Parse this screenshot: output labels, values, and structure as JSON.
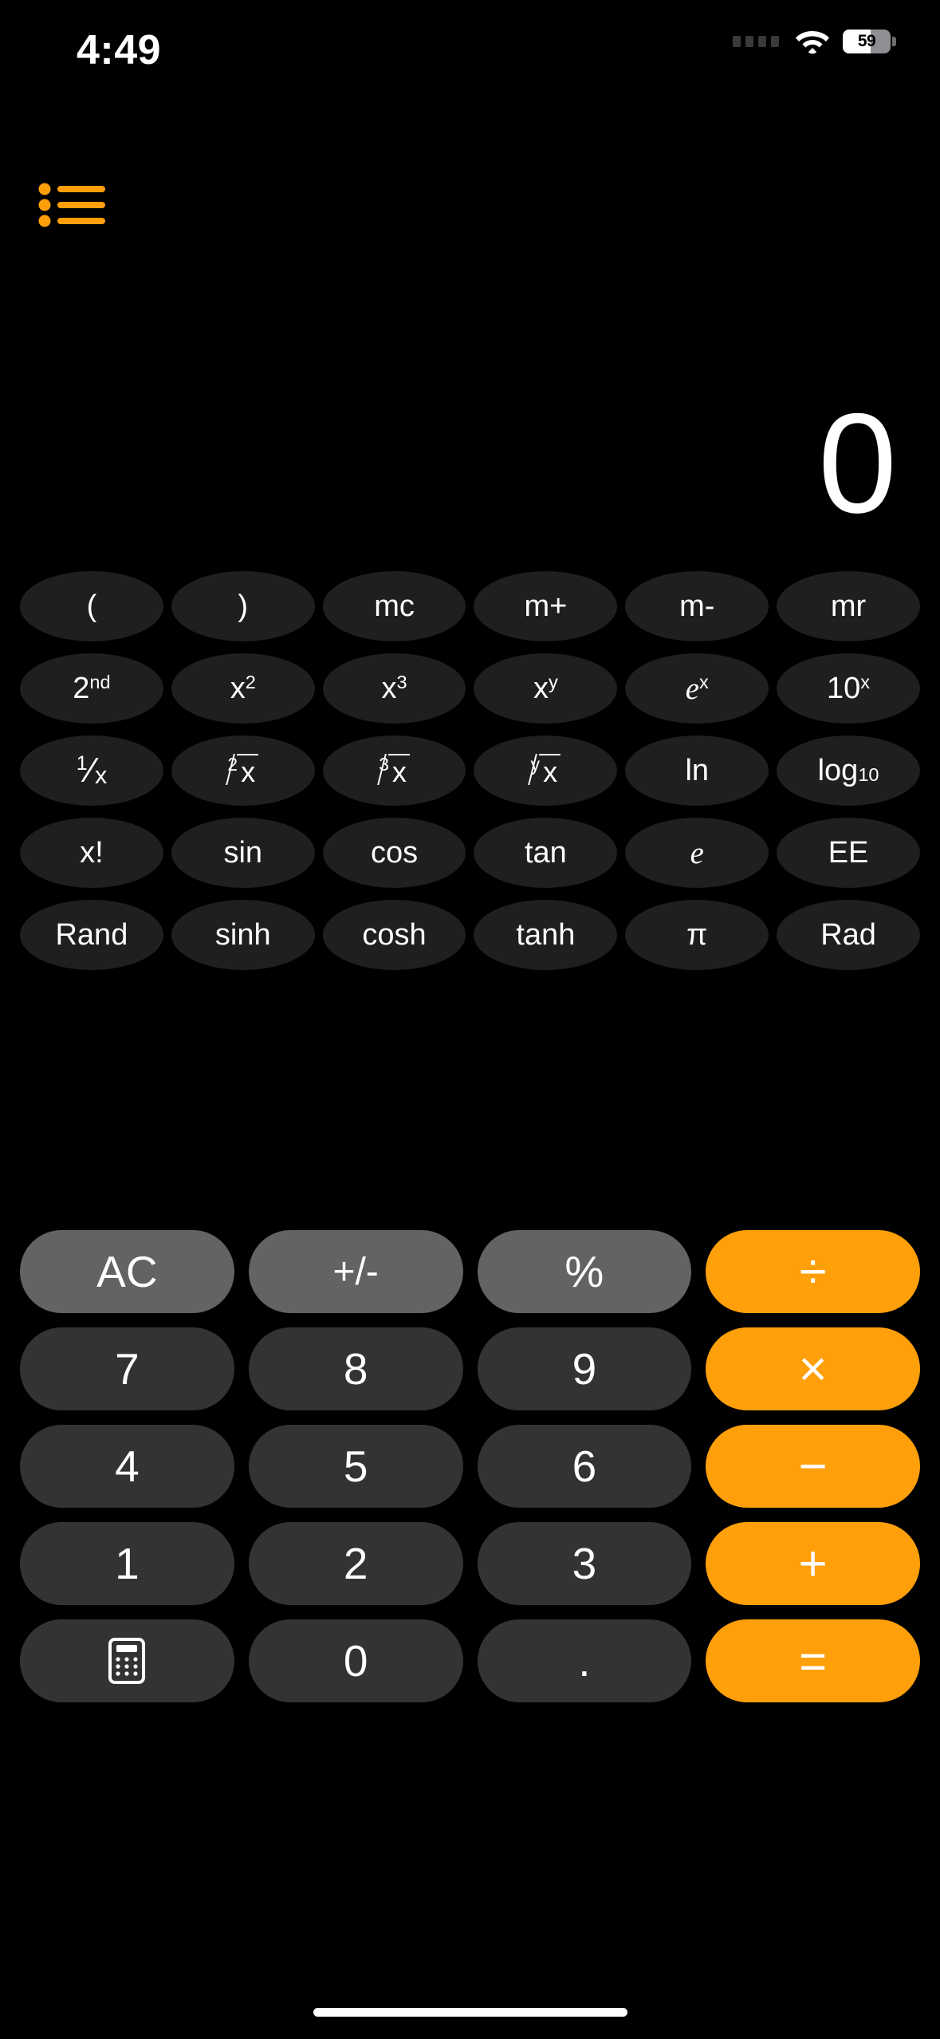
{
  "status_bar": {
    "time": "4:49",
    "battery_percent": "59",
    "battery_level": 59,
    "wifi_icon": "wifi-icon",
    "signal_icon": "signal-dots-icon"
  },
  "toolbar": {
    "history_label": "history-list-icon",
    "accent_color": "#ff9f0a"
  },
  "display": {
    "value": "0"
  },
  "colors": {
    "background": "#000000",
    "sci_key": "#1f1f1f",
    "digit_key": "#333333",
    "function_key": "#636366",
    "operator_key": "#ff9f0a",
    "text": "#ffffff"
  },
  "scientific_rows": [
    [
      {
        "label": "(",
        "name": "key-open-paren"
      },
      {
        "label": ")",
        "name": "key-close-paren"
      },
      {
        "label": "mc",
        "name": "key-memory-clear"
      },
      {
        "label": "m+",
        "name": "key-memory-add"
      },
      {
        "label": "m-",
        "name": "key-memory-subtract"
      },
      {
        "label": "mr",
        "name": "key-memory-recall"
      }
    ],
    [
      {
        "label": "2nd",
        "name": "key-second"
      },
      {
        "label": "x2",
        "name": "key-x-squared"
      },
      {
        "label": "x3",
        "name": "key-x-cubed"
      },
      {
        "label": "xy",
        "name": "key-x-power-y"
      },
      {
        "label": "ex",
        "name": "key-e-power-x"
      },
      {
        "label": "10x",
        "name": "key-ten-power-x"
      }
    ],
    [
      {
        "label": "1/x",
        "name": "key-reciprocal"
      },
      {
        "label": "2√x",
        "name": "key-square-root"
      },
      {
        "label": "3√x",
        "name": "key-cube-root"
      },
      {
        "label": "y√x",
        "name": "key-nth-root"
      },
      {
        "label": "ln",
        "name": "key-natural-log"
      },
      {
        "label": "log10",
        "name": "key-log-base-10"
      }
    ],
    [
      {
        "label": "x!",
        "name": "key-factorial"
      },
      {
        "label": "sin",
        "name": "key-sin"
      },
      {
        "label": "cos",
        "name": "key-cos"
      },
      {
        "label": "tan",
        "name": "key-tan"
      },
      {
        "label": "e",
        "name": "key-euler"
      },
      {
        "label": "EE",
        "name": "key-exponent"
      }
    ],
    [
      {
        "label": "Rand",
        "name": "key-random"
      },
      {
        "label": "sinh",
        "name": "key-sinh"
      },
      {
        "label": "cosh",
        "name": "key-cosh"
      },
      {
        "label": "tanh",
        "name": "key-tanh"
      },
      {
        "label": "π",
        "name": "key-pi"
      },
      {
        "label": "Rad",
        "name": "key-rad"
      }
    ]
  ],
  "sci_labels": {
    "r0": {
      "c0": "(",
      "c1": ")",
      "c2": "mc",
      "c3": "m+",
      "c4": "m-",
      "c5": "mr"
    },
    "r1": {
      "c0_base": "2",
      "c0_sup": "nd",
      "c1_base": "x",
      "c1_sup": "2",
      "c2_base": "x",
      "c2_sup": "3",
      "c3_base": "x",
      "c3_sup": "y",
      "c4_base": "e",
      "c4_sup": "x",
      "c5_base": "10",
      "c5_sup": "x"
    },
    "r2": {
      "c0_num": "1",
      "c0_den": "x",
      "c1_idx": "2",
      "c1_val": "x",
      "c2_idx": "3",
      "c2_val": "x",
      "c3_idx": "y",
      "c3_val": "x",
      "c4": "ln",
      "c5_base": "log",
      "c5_sub": "10"
    },
    "r3": {
      "c0": "x!",
      "c1": "sin",
      "c2": "cos",
      "c3": "tan",
      "c4": "e",
      "c5": "EE"
    },
    "r4": {
      "c0": "Rand",
      "c1": "sinh",
      "c2": "cosh",
      "c3": "tanh",
      "c4": "π",
      "c5": "Rad"
    }
  },
  "main_keypad": {
    "rows": [
      [
        {
          "label": "AC",
          "name": "key-all-clear",
          "type": "function"
        },
        {
          "label": "+/-",
          "name": "key-sign-toggle",
          "type": "function"
        },
        {
          "label": "%",
          "name": "key-percent",
          "type": "function"
        },
        {
          "label": "÷",
          "name": "key-divide",
          "type": "operator"
        }
      ],
      [
        {
          "label": "7",
          "name": "key-7",
          "type": "digit"
        },
        {
          "label": "8",
          "name": "key-8",
          "type": "digit"
        },
        {
          "label": "9",
          "name": "key-9",
          "type": "digit"
        },
        {
          "label": "×",
          "name": "key-multiply",
          "type": "operator"
        }
      ],
      [
        {
          "label": "4",
          "name": "key-4",
          "type": "digit"
        },
        {
          "label": "5",
          "name": "key-5",
          "type": "digit"
        },
        {
          "label": "6",
          "name": "key-6",
          "type": "digit"
        },
        {
          "label": "−",
          "name": "key-subtract",
          "type": "operator"
        }
      ],
      [
        {
          "label": "1",
          "name": "key-1",
          "type": "digit"
        },
        {
          "label": "2",
          "name": "key-2",
          "type": "digit"
        },
        {
          "label": "3",
          "name": "key-3",
          "type": "digit"
        },
        {
          "label": "+",
          "name": "key-add",
          "type": "operator"
        }
      ],
      [
        {
          "label": "calculator-icon",
          "name": "key-calculator-mode",
          "type": "digit"
        },
        {
          "label": "0",
          "name": "key-0",
          "type": "digit"
        },
        {
          "label": ".",
          "name": "key-decimal",
          "type": "digit"
        },
        {
          "label": "=",
          "name": "key-equals",
          "type": "operator"
        }
      ]
    ],
    "labels": {
      "ac": "AC",
      "plusminus": "+/-",
      "percent": "%",
      "divide": "÷",
      "seven": "7",
      "eight": "8",
      "nine": "9",
      "multiply": "×",
      "four": "4",
      "five": "5",
      "six": "6",
      "minus": "−",
      "one": "1",
      "two": "2",
      "three": "3",
      "plus": "+",
      "calc_icon": "calculator-icon",
      "zero": "0",
      "dot": ".",
      "equals": "="
    }
  }
}
